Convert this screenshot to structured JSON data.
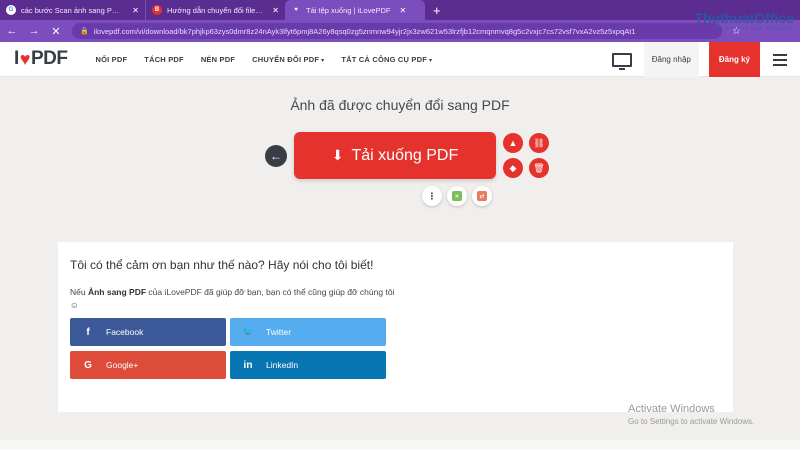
{
  "browser": {
    "tabs": [
      {
        "title": "các bước Scan ảnh sang PDF onli",
        "favicon": "G"
      },
      {
        "title": "Hướng dẫn chuyển đổi file Excel",
        "favicon": "B"
      },
      {
        "title": "Tải tệp xuống | iLovePDF",
        "favicon": "♥"
      }
    ],
    "new_tab": "+",
    "url": "ilovepdf.com/vi/download/bk7phjkp63zys0dmr8z24nAyk3lfyt6pmj8A26y8qsq0zg5znmnw94yjr2jx3zw621w53lrzfjb12cmqnmvq8g5c2vxjc7cs72vsf7vxA2vz5z5xpqAt1"
  },
  "site": {
    "logo_left": "I",
    "logo_heart": "♥",
    "logo_right": "PDF",
    "menu": [
      "NỐI PDF",
      "TÁCH PDF",
      "NÉN PDF",
      "CHUYỂN ĐỔI PDF",
      "TẤT CẢ CÔNG CỤ PDF"
    ],
    "caret": "▾",
    "login": "Đăng nhập",
    "signup": "Đăng ký"
  },
  "watermark": {
    "title": "ThuthuatOffice",
    "sub": "TRI KY CUA DAN CONG SO"
  },
  "main": {
    "title": "Ảnh đã được chuyển đổi sang PDF",
    "download_label": "Tải xuống PDF",
    "more": "⋮"
  },
  "card": {
    "title": "Tôi có thể cảm ơn bạn như thế nào? Hãy nói cho tôi biết!",
    "text_prefix": "Nếu ",
    "text_bold": "Ảnh sang PDF",
    "text_suffix": " của iLovePDF đã giúp đỡ bạn, bạn có thể cũng giúp đỡ chúng tôi ☺",
    "share": {
      "facebook": "Facebook",
      "twitter": "Twitter",
      "google": "Google+",
      "linkedin": "LinkedIn"
    }
  },
  "activate": {
    "line1": "Activate Windows",
    "line2": "Go to Settings to activate Windows."
  }
}
